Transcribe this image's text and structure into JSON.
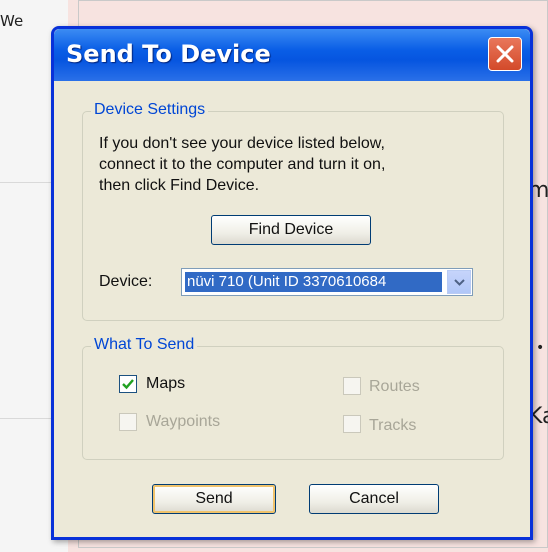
{
  "background": {
    "left_tab_text": "We",
    "map_texts": [
      "m",
      "Ka",
      "•"
    ]
  },
  "dialog": {
    "title": "Send To Device",
    "device_settings": {
      "group_label": "Device Settings",
      "info_lines": [
        "If you don't see your device listed below,",
        "connect it to the computer and turn it on,",
        "then click Find Device."
      ],
      "find_device_label": "Find Device",
      "device_label": "Device:",
      "device_value": "nüvi 710 (Unit ID 3370610684"
    },
    "what_to_send": {
      "group_label": "What To Send",
      "options": {
        "maps": {
          "label": "Maps",
          "checked": true,
          "enabled": true
        },
        "routes": {
          "label": "Routes",
          "checked": false,
          "enabled": false
        },
        "waypoints": {
          "label": "Waypoints",
          "checked": false,
          "enabled": false
        },
        "tracks": {
          "label": "Tracks",
          "checked": false,
          "enabled": false
        }
      }
    },
    "send_label": "Send",
    "cancel_label": "Cancel"
  },
  "colors": {
    "title_bar": "#0a5ee6",
    "group_label": "#0046d5",
    "selection": "#316ac5",
    "dialog_bg": "#ece9d8"
  }
}
